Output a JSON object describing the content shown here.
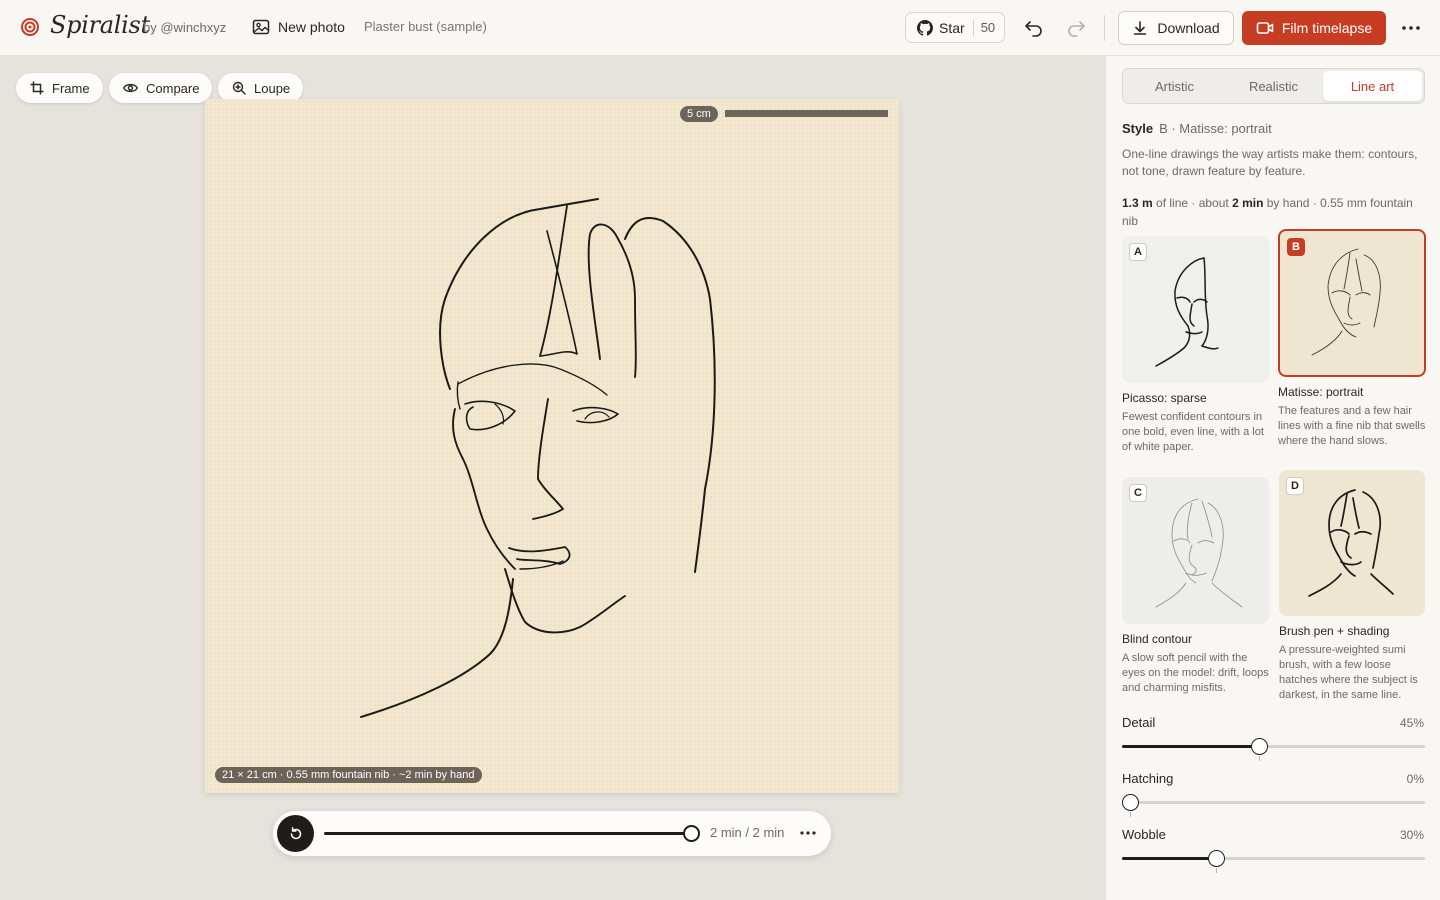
{
  "app": {
    "brand": "Spiralist",
    "byline": "by @winchxyz",
    "new_photo_label": "New photo",
    "sample_name": "Plaster bust (sample)",
    "accent": "#c63d23"
  },
  "topbar": {
    "star_label": "Star",
    "star_count": "50",
    "download_label": "Download",
    "film_label": "Film timelapse"
  },
  "canvas_tools": {
    "frame": "Frame",
    "compare": "Compare",
    "loupe": "Loupe"
  },
  "canvas": {
    "scale_label": "5 cm",
    "caption": "21 × 21 cm · 0.55 mm fountain nib · ~2 min by hand",
    "paper_color": "#f2e7cf"
  },
  "player": {
    "time": "2 min / 2 min",
    "progress": 1.0
  },
  "panel": {
    "tabs": [
      {
        "label": "Artistic",
        "active": false
      },
      {
        "label": "Realistic",
        "active": false
      },
      {
        "label": "Line art",
        "active": true
      }
    ],
    "style_heading": "Style",
    "style_selected": "B · Matisse: portrait",
    "description": "One-line drawings the way artists make them: contours, not tone, drawn feature by feature.",
    "stats": {
      "length": "1.3 m",
      "length_suffix": " of line · about ",
      "time": "2 min",
      "time_suffix": " by hand · 0.55 mm fountain nib"
    },
    "styles": [
      {
        "letter": "A",
        "title": "Picasso: sparse",
        "desc": "Fewest confident contours in one bold, even line, with a lot of white paper.",
        "selected": false
      },
      {
        "letter": "B",
        "title": "Matisse: portrait",
        "desc": "The features and a few hair lines with a fine nib that swells where the hand slows.",
        "selected": true
      },
      {
        "letter": "C",
        "title": "Blind contour",
        "desc": "A slow soft pencil with the eyes on the model: drift, loops and charming misfits.",
        "selected": false
      },
      {
        "letter": "D",
        "title": "Brush pen + shading",
        "desc": "A pressure-weighted sumi brush, with a few loose hatches where the subject is darkest, in the same line.",
        "selected": false
      }
    ],
    "sliders": [
      {
        "label": "Detail",
        "value_text": "45%",
        "value": 0.45
      },
      {
        "label": "Hatching",
        "value_text": "0%",
        "value": 0.0
      },
      {
        "label": "Wobble",
        "value_text": "30%",
        "value": 0.3
      }
    ]
  },
  "icons": {
    "logo": "spiral-icon",
    "new_photo": "image-icon",
    "star": "github-icon",
    "undo": "undo-icon",
    "redo": "redo-icon",
    "download": "download-icon",
    "film": "video-icon",
    "more": "more-horizontal-icon"
  }
}
